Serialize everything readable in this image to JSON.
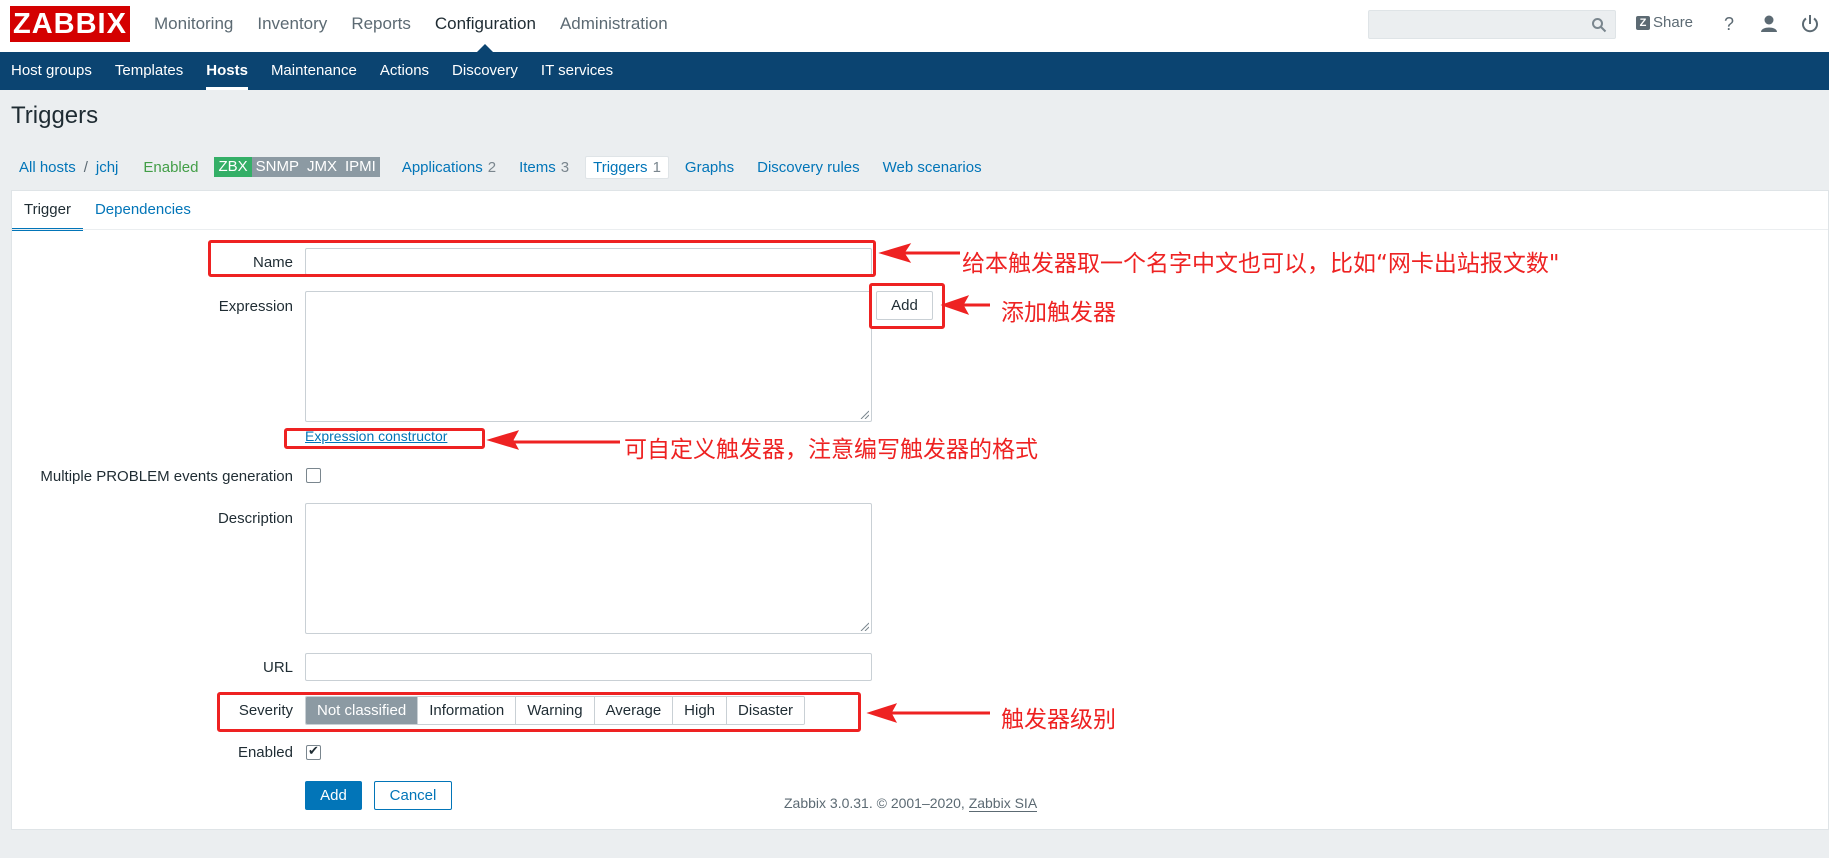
{
  "logo": "ZABBIX",
  "main_nav": [
    "Monitoring",
    "Inventory",
    "Reports",
    "Configuration",
    "Administration"
  ],
  "main_nav_active": "Configuration",
  "header": {
    "share": "Share",
    "help": "?",
    "search_value": ""
  },
  "sub_nav": [
    "Host groups",
    "Templates",
    "Hosts",
    "Maintenance",
    "Actions",
    "Discovery",
    "IT services"
  ],
  "sub_nav_active": "Hosts",
  "page_title": "Triggers",
  "breadcrumb": {
    "all_hosts": "All hosts",
    "sep": "/",
    "host": "jchj",
    "status": "Enabled",
    "badges": [
      "ZBX",
      "SNMP",
      "JMX",
      "IPMI"
    ],
    "links": [
      {
        "label": "Applications",
        "count": "2"
      },
      {
        "label": "Items",
        "count": "3"
      },
      {
        "label": "Triggers",
        "count": "1"
      },
      {
        "label": "Graphs",
        "count": ""
      },
      {
        "label": "Discovery rules",
        "count": ""
      },
      {
        "label": "Web scenarios",
        "count": ""
      }
    ]
  },
  "tabs": [
    "Trigger",
    "Dependencies"
  ],
  "form": {
    "name_label": "Name",
    "name_value": "",
    "expression_label": "Expression",
    "expression_value": "",
    "add_expression": "Add",
    "expression_constructor": "Expression constructor",
    "multiple_label": "Multiple PROBLEM events generation",
    "multiple_checked": false,
    "description_label": "Description",
    "description_value": "",
    "url_label": "URL",
    "url_value": "",
    "severity_label": "Severity",
    "severity_options": [
      "Not classified",
      "Information",
      "Warning",
      "Average",
      "High",
      "Disaster"
    ],
    "severity_selected": "Not classified",
    "enabled_label": "Enabled",
    "enabled_checked": true,
    "submit": "Add",
    "cancel": "Cancel"
  },
  "footer": {
    "text": "Zabbix 3.0.31. © 2001–2020,",
    "vendor": "Zabbix SIA"
  },
  "annotations": {
    "name_note": "给本触发器取一个名字中文也可以，比如“网卡出站报文数\"",
    "add_note": "添加触发器",
    "constructor_note": "可自定义触发器，注意编写触发器的格式",
    "severity_note": "触发器级别"
  },
  "colors": {
    "brand_red": "#d40000",
    "nav_blue": "#0b4471",
    "link": "#0275b8",
    "annotation": "#ee2222",
    "enabled_green": "#429e47"
  }
}
